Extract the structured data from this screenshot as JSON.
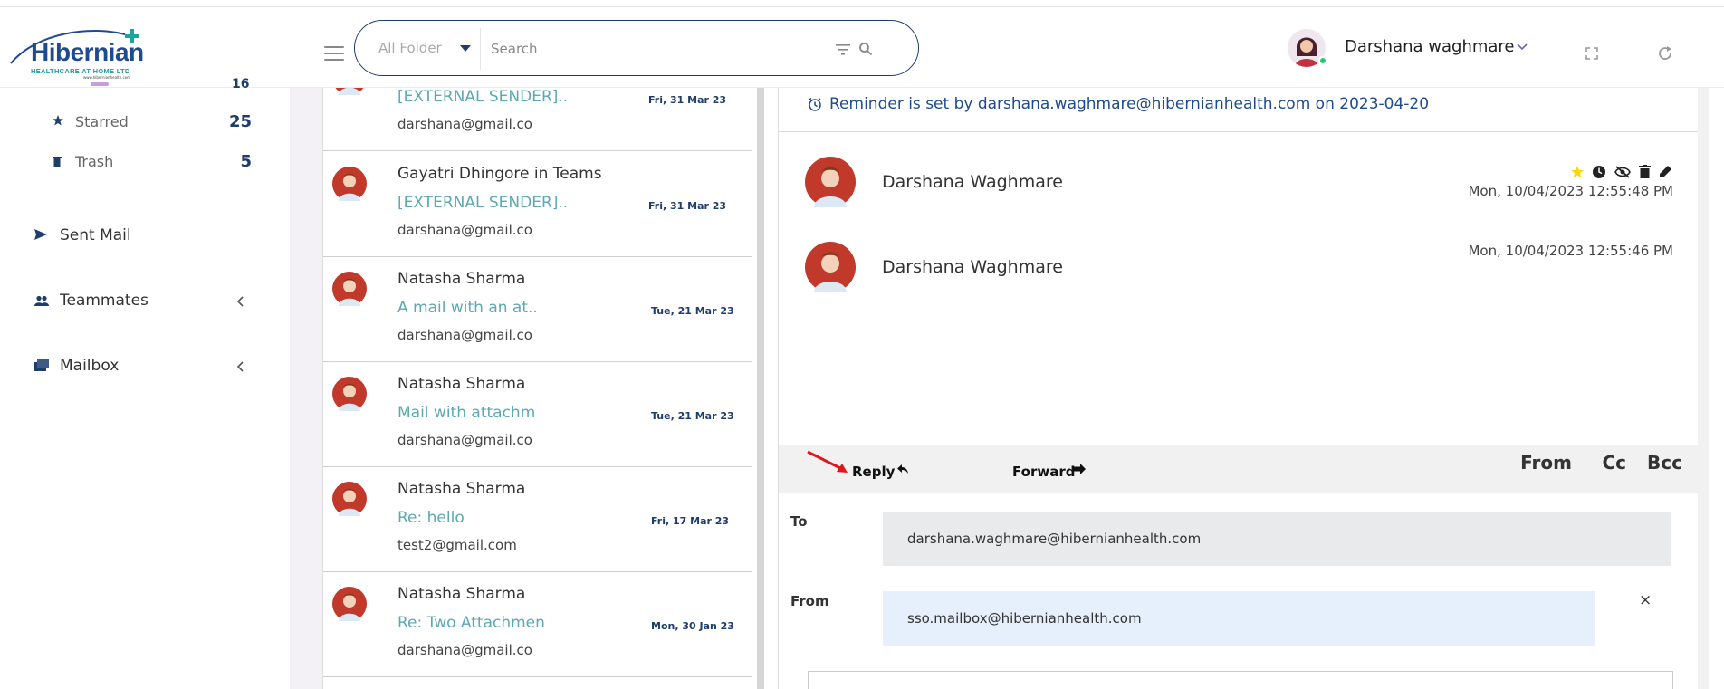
{
  "header": {
    "logo": {
      "name": "Hibernian",
      "subtitle": "HEALTHCARE AT HOME LTD",
      "url": "www.hibernianhealth.com"
    },
    "search": {
      "folder": "All Folder",
      "placeholder": "Search"
    },
    "user": {
      "name": "Darshana waghmare"
    }
  },
  "sidebar": {
    "sub_items": [
      {
        "label": "Starred",
        "count": "25",
        "icon": "star-icon"
      },
      {
        "label": "Trash",
        "count": "5",
        "icon": "trash-icon"
      }
    ],
    "cut_count": "16",
    "main_items": [
      {
        "label": "Sent Mail",
        "icon": "send-icon"
      },
      {
        "label": "Teammates",
        "icon": "people-icon"
      },
      {
        "label": "Mailbox",
        "icon": "folder-icon"
      }
    ]
  },
  "mail_list": [
    {
      "sender": "",
      "subject": "[EXTERNAL SENDER]..",
      "date": "Fri, 31 Mar 23",
      "email": "darshana@gmail.co"
    },
    {
      "sender": "Gayatri Dhingore in Teams",
      "subject": "[EXTERNAL SENDER]..",
      "date": "Fri, 31 Mar 23",
      "email": "darshana@gmail.co"
    },
    {
      "sender": "Natasha Sharma",
      "subject": "A mail with an at..",
      "date": "Tue, 21 Mar 23",
      "email": "darshana@gmail.co"
    },
    {
      "sender": "Natasha Sharma",
      "subject": "Mail with attachm",
      "date": "Tue, 21 Mar 23",
      "email": "darshana@gmail.co"
    },
    {
      "sender": "Natasha Sharma",
      "subject": "Re: hello",
      "date": "Fri, 17 Mar 23",
      "email": "test2@gmail.com"
    },
    {
      "sender": "Natasha Sharma",
      "subject": "Re: Two Attachmen",
      "date": "Mon, 30 Jan 23",
      "email": "darshana@gmail.co"
    }
  ],
  "reading_pane": {
    "reminder": "Reminder is set by darshana.waghmare@hibernianhealth.com on 2023-04-20",
    "messages": [
      {
        "name": "Darshana Waghmare",
        "date": "Mon, 10/04/2023 12:55:48 PM"
      },
      {
        "name": "Darshana Waghmare",
        "date": "Mon, 10/04/2023 12:55:46 PM"
      }
    ],
    "compose": {
      "reply_label": "Reply",
      "forward_label": "Forward",
      "from_toggle": "From",
      "cc_toggle": "Cc",
      "bcc_toggle": "Bcc",
      "to_label": "To",
      "to_value": "darshana.waghmare@hibernianhealth.com",
      "from_label": "From",
      "from_value": "sso.mailbox@hibernianhealth.com",
      "close_symbol": "×"
    }
  },
  "colors": {
    "brand_navy": "#1f3d6b",
    "subject_teal": "#5ba9b2",
    "reminder_blue": "#1f4a8f",
    "star_yellow": "#f5d90a",
    "arrow_red": "#e0151b"
  }
}
